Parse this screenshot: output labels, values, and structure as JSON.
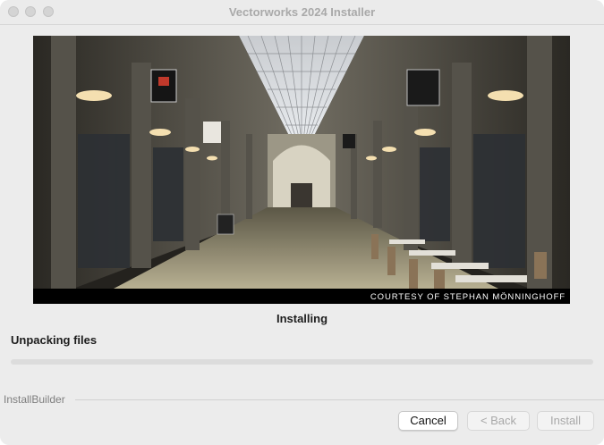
{
  "window": {
    "title": "Vectorworks 2024 Installer"
  },
  "banner": {
    "caption": "COURTESY OF STEPHAN MÖNNINGHOFF"
  },
  "status": {
    "title": "Installing",
    "step": "Unpacking files",
    "progress": 0
  },
  "footer": {
    "brand": "InstallBuilder",
    "cancel_label": "Cancel",
    "back_label": "< Back",
    "install_label": "Install"
  }
}
